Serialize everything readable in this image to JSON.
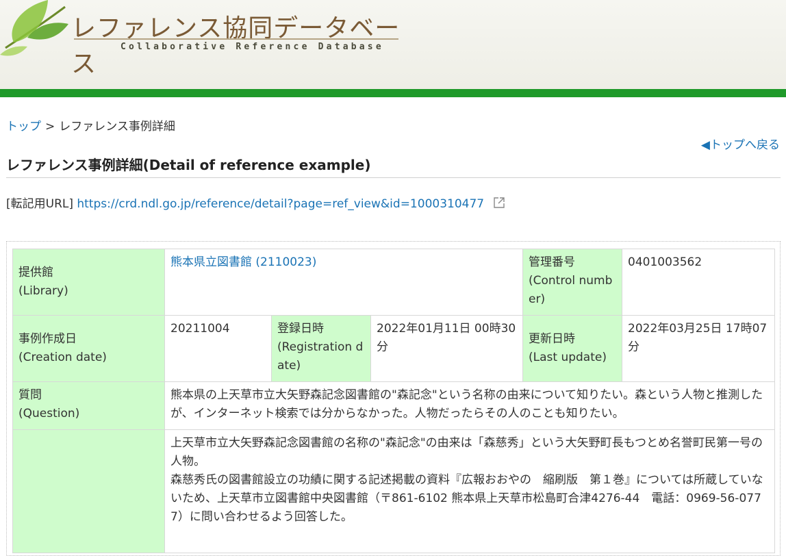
{
  "logo": {
    "title": "レファレンス協同データベース",
    "subtitle": "Collaborative Reference Database"
  },
  "breadcrumb": {
    "top": "トップ",
    "separator": ">",
    "current": "レファレンス事例詳細"
  },
  "back_link": "◀トップへ戻る",
  "page_title": "レファレンス事例詳細(Detail of reference example)",
  "url_row": {
    "label": "[転記用URL]",
    "url": "https://crd.ndl.go.jp/reference/detail?page=ref_view&id=1000310477",
    "icon": "external-link-icon"
  },
  "table": {
    "library_label": "提供館",
    "library_label_en": "(Library)",
    "library_value": "熊本県立図書館 (2110023)",
    "control_label": "管理番号",
    "control_label_en": "(Control number)",
    "control_value": "0401003562",
    "creation_label": "事例作成日",
    "creation_label_en": "(Creation date)",
    "creation_value": "20211004",
    "registration_label": "登録日時",
    "registration_label_en": "(Registration date)",
    "registration_value": "2022年01月11日 00時30分",
    "update_label": "更新日時",
    "update_label_en": "(Last update)",
    "update_value": "2022年03月25日 17時07分",
    "question_label": "質問",
    "question_label_en": "(Question)",
    "question_value": "熊本県の上天草市立大矢野森記念図書館の\"森記念\"という名称の由来について知りたい。森という人物と推測したが、インターネット検索では分からなかった。人物だったらその人のことも知りたい。",
    "answer_line1": "上天草市立大矢野森記念図書館の名称の\"森記念\"の由来は「森慈秀」という大矢野町長もつとめ名誉町民第一号の人物。",
    "answer_line2": "森慈秀氏の図書館設立の功績に関する記述掲載の資料『広報おおやの　縮刷版　第１巻』については所蔵していないため、上天草市立図書館中央図書館（〒861-6102 熊本県上天草市松島町合津4276-44　電話：0969-56-0777）に問い合わせるよう回答した。"
  },
  "colors": {
    "header_bar": "#1f9a2a",
    "label_cell": "#cffccc",
    "link": "#1a73b5"
  }
}
